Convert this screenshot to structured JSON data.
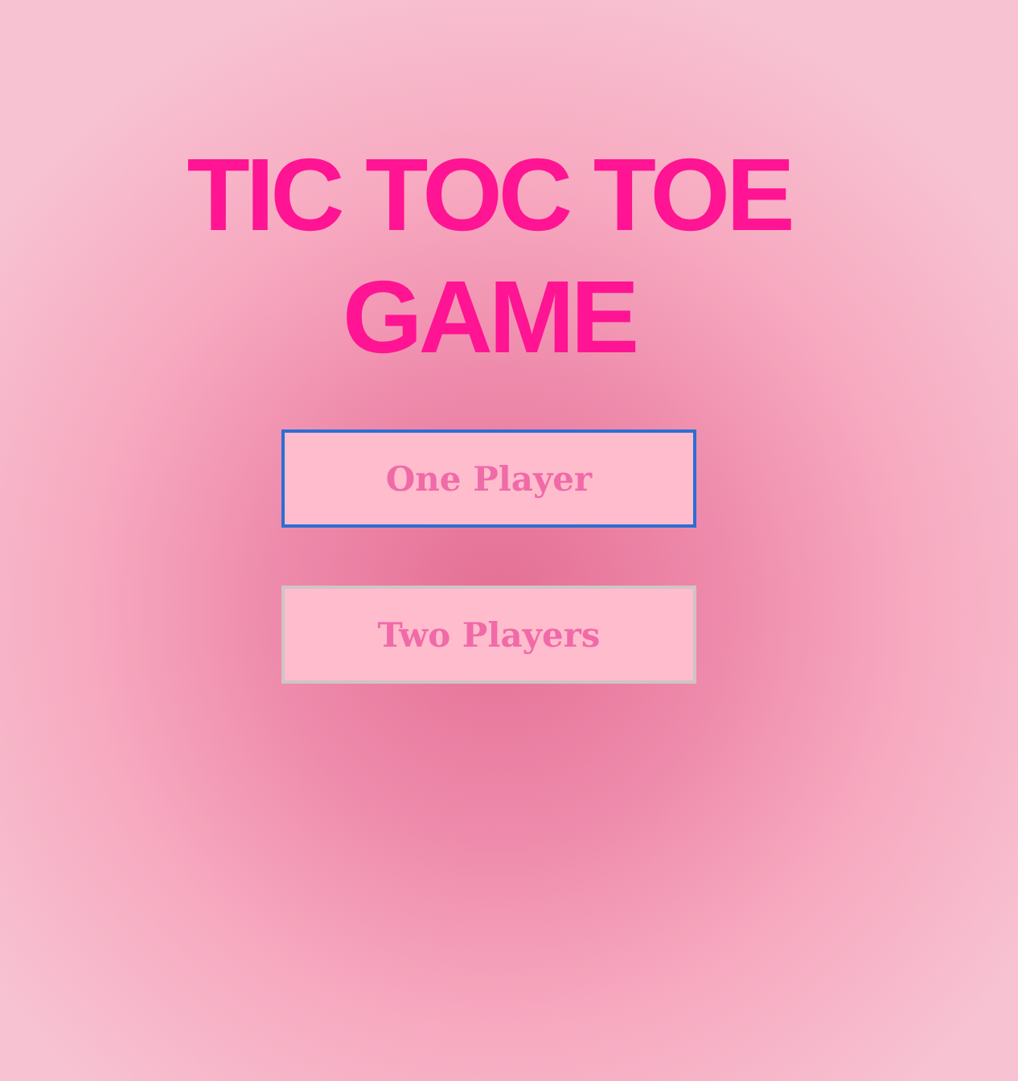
{
  "title": "TIC TOC TOE GAME",
  "buttons": [
    {
      "label": "One Player",
      "focused": true
    },
    {
      "label": "Two Players",
      "focused": false
    }
  ]
}
